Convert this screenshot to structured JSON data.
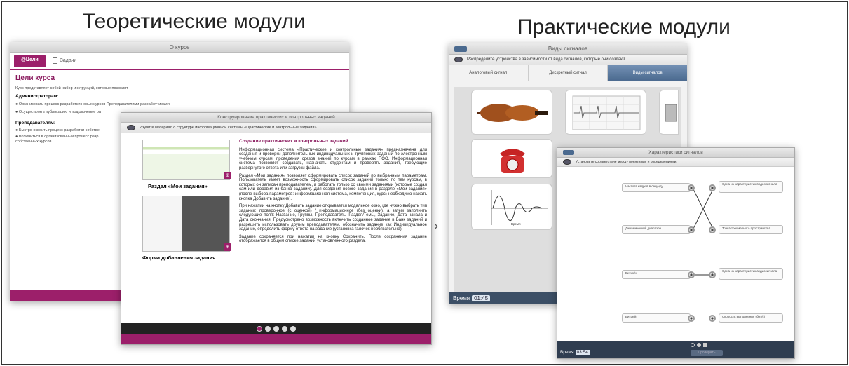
{
  "headings": {
    "theory": "Теоретические модули",
    "practice": "Практические модули"
  },
  "course_window": {
    "title": "О курсе",
    "tabs": [
      "@Цели",
      "Задачи"
    ],
    "section_title": "Цели курса",
    "intro": "Курс представляет собой набор инструкций, которые позволят",
    "admins_label": "Администраторам:",
    "admin_bullets": [
      "Организовать процесс разработки новых курсов Преподавателями-разработчиками",
      "Осуществлять публикацию и подключение ра"
    ],
    "teachers_label": "Преподавателям:",
    "teacher_bullets": [
      "Быстро освоить процесс разработки собстве",
      "Включиться в организованный процесс разр собственных курсов"
    ]
  },
  "constructor_window": {
    "title": "Конструирование практических и контрольных заданий",
    "hint": "Изучите материал о структуре информационной системы «Практические и контрольные задания».",
    "caption1": "Раздел «Мои задания»",
    "caption2": "Форма добавления задания",
    "article_title": "Создание практических и контрольных заданий",
    "p1": "Информационная система «Практические и контрольные задания» предназначена для создания и проверки дополнительных индивидуальных и групповых заданий по электронным учебным курсам, проведения срезов знаний по курсам в рамках ПОО. Информационная система позволяет создавать, назначать студентам и проверять задания, требующие развернутого ответа или загрузки файла.",
    "p2": "Раздел «Мои задания» позволяет сформировать список заданий по выбранным параметрам. Пользователь имеет возможность сформировать список заданий только по тем курсам, в которых он записан преподавателем, и работать только со своими заданиями (которые создал сам или добавил из банка заданий). Для создания нового задания в разделе «Мои задания» (после выбора параметров: информационная система, компетенция, курс) необходимо нажать кнопка Добавить задание).",
    "p3": "При нажатии на кнопку Добавить задание открывается модальное окно, где нужно выбрать тип задания: проверочное (с оценкой) / информационное (без оценки), а затем заполнить следующие поля: Название, Группы, Преподаватель, Раздел/Темы, Задание, Дата начала и Дата окончания. Предусмотрено возможность включить созданное задание в Банк заданий и разрешить использовать другим преподавателям, обозначить задание как Индивидуальное задание, определить форму ответа на задание (установка галочек необязательна).",
    "p4": "Задание сохраняется при нажатии на кнопку Сохранить. После сохранения задание отображается в общем списке заданий установленного раздела.",
    "next_arrow": "›"
  },
  "signals_window": {
    "title": "Виды сигналов",
    "hint": "Распределите устройства в зависимости от вида сигналов, которые они создают.",
    "columns": [
      "Аналоговый сигнал",
      "Дискретный сигнал",
      "Виды сигналов"
    ],
    "axis_label": "Время",
    "time_label": "Время",
    "time_value": "01:45"
  },
  "match_window": {
    "title": "Характеристики сигналов",
    "hint": "Установите соответствие между понятиями и определениями.",
    "left": [
      "Частота кадров в секунду",
      "Динамический диапазон",
      "Биткойн",
      "Битрейт"
    ],
    "right": [
      "Одна из характеристик видеосигнала",
      "Точка трехмерного пространства",
      "Одна из характеристик аудиосигнала",
      "Скорость выполнения (бит/с)"
    ],
    "check_label": "Проверить",
    "time_label": "Время",
    "time_value": "03:54"
  },
  "colors": {
    "accent": "#9c1f6a",
    "dark": "#222222",
    "steel": "#4b6a8f"
  }
}
